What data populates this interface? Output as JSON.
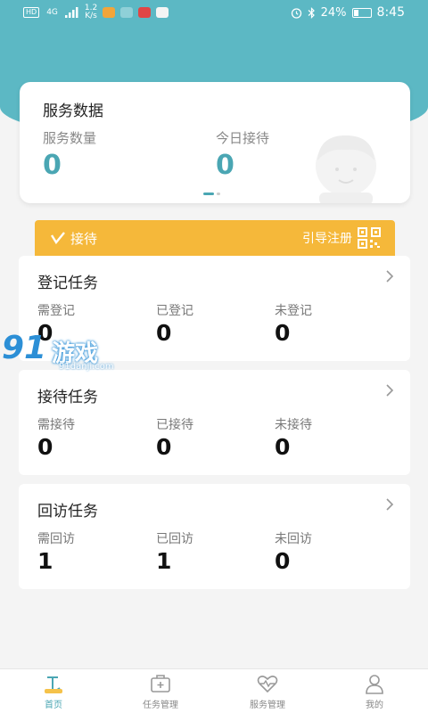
{
  "status_bar": {
    "hd_badge": "HD",
    "signal_tag": "4G",
    "speed_value": "1.2",
    "speed_unit": "K/s",
    "battery": "24%",
    "time": "8:45"
  },
  "service_card": {
    "title": "服务数据",
    "stats": [
      {
        "label": "服务数量",
        "value": "0"
      },
      {
        "label": "今日接待",
        "value": "0"
      }
    ]
  },
  "reception": {
    "label": "接待",
    "guide_label": "引导注册"
  },
  "tasks": [
    {
      "title": "登记任务",
      "columns": [
        {
          "label": "需登记",
          "value": "0"
        },
        {
          "label": "已登记",
          "value": "0"
        },
        {
          "label": "未登记",
          "value": "0"
        }
      ]
    },
    {
      "title": "接待任务",
      "columns": [
        {
          "label": "需接待",
          "value": "0"
        },
        {
          "label": "已接待",
          "value": "0"
        },
        {
          "label": "未接待",
          "value": "0"
        }
      ]
    },
    {
      "title": "回访任务",
      "columns": [
        {
          "label": "需回访",
          "value": "1"
        },
        {
          "label": "已回访",
          "value": "1"
        },
        {
          "label": "未回访",
          "value": "0"
        }
      ]
    }
  ],
  "watermark": {
    "number": "91",
    "name": "游戏",
    "url": "91danji.com"
  },
  "tabbar": {
    "items": [
      {
        "label": "首页",
        "icon": "home-icon",
        "active": true
      },
      {
        "label": "任务管理",
        "icon": "task-kit-icon",
        "active": false
      },
      {
        "label": "服务管理",
        "icon": "service-heart-icon",
        "active": false
      },
      {
        "label": "我的",
        "icon": "profile-icon",
        "active": false
      }
    ]
  },
  "colors": {
    "primary": "#5cb8c4",
    "accent_value": "#4aa6b3",
    "reception_bg": "#f5b83a",
    "background": "#f4f4f4"
  }
}
